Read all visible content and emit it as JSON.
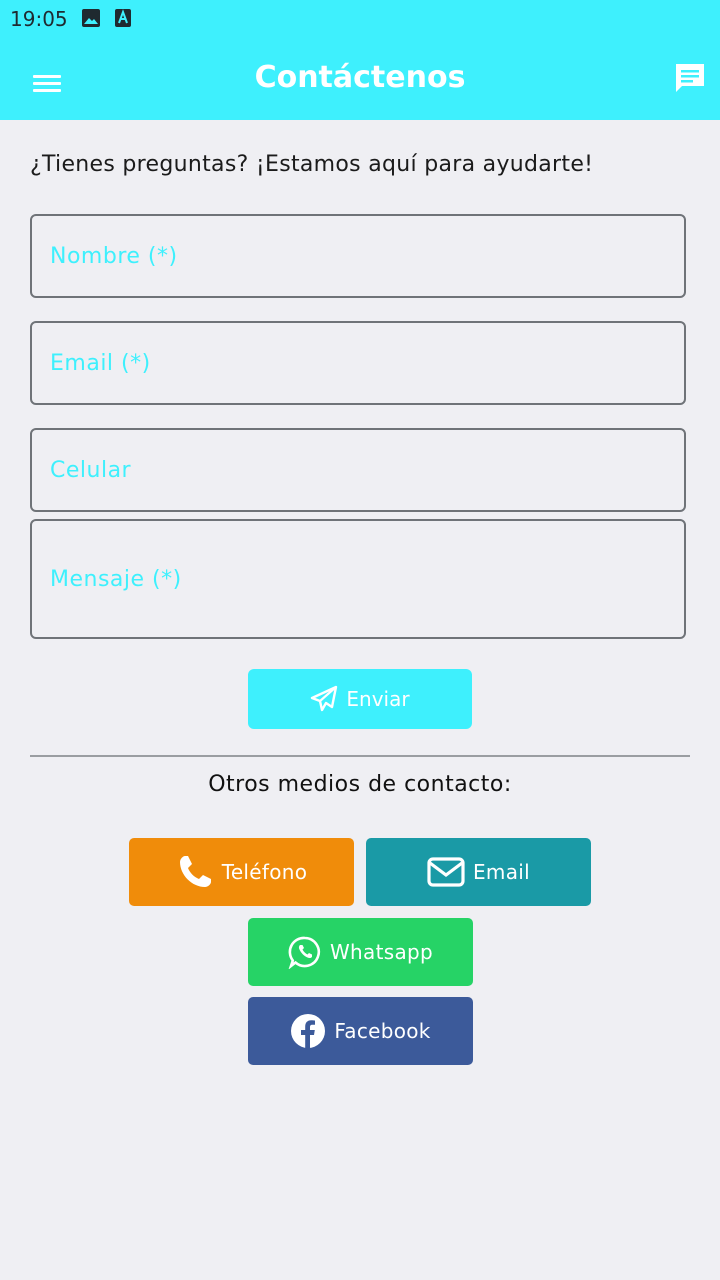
{
  "status_bar": {
    "time": "19:05",
    "icons": [
      "image-icon",
      "text-a-icon"
    ]
  },
  "app_bar": {
    "title": "Contáctenos",
    "menu_icon": "menu-icon",
    "chat_icon": "chat-icon",
    "accent": "#3ef0fd"
  },
  "intro_text": "¿Tienes preguntas? ¡Estamos aquí para ayudarte!",
  "form": {
    "name_placeholder": "Nombre (*)",
    "email_placeholder": "Email (*)",
    "phone_placeholder": "Celular",
    "message_placeholder": "Mensaje (*)",
    "submit_label": "Enviar",
    "submit_icon": "paper-plane-icon"
  },
  "other_contacts": {
    "title": "Otros medios de contacto:",
    "buttons": [
      {
        "label": "Teléfono",
        "icon": "phone-icon",
        "color": "#f08c0a"
      },
      {
        "label": "Email",
        "icon": "envelope-icon",
        "color": "#1a9aa6"
      },
      {
        "label": "Whatsapp",
        "icon": "whatsapp-icon",
        "color": "#26d366"
      },
      {
        "label": "Facebook",
        "icon": "facebook-icon",
        "color": "#3c5a9a"
      }
    ]
  }
}
